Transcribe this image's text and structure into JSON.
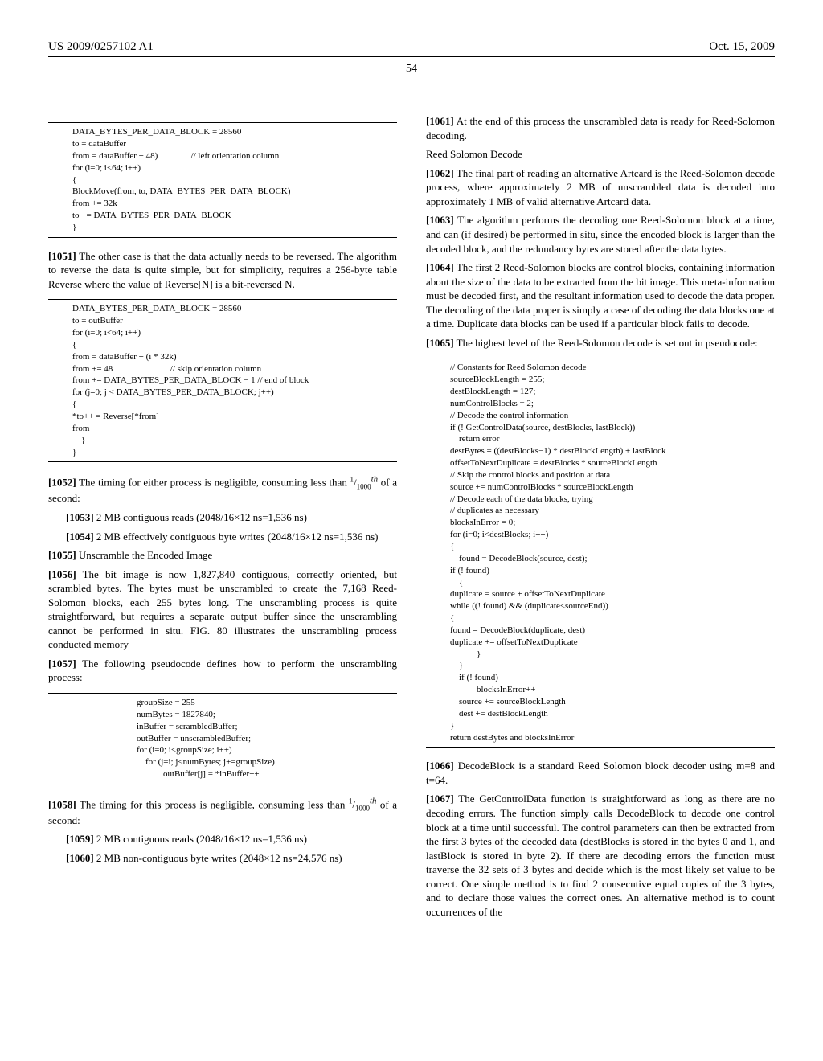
{
  "header": {
    "pub": "US 2009/0257102 A1",
    "date": "Oct. 15, 2009"
  },
  "pagenum": "54",
  "left": {
    "code1": "DATA_BYTES_PER_DATA_BLOCK = 28560\nto = dataBuffer\nfrom = dataBuffer + 48)               // left orientation column\nfor (i=0; i<64; i++)\n{\nBlockMove(from, to, DATA_BYTES_PER_DATA_BLOCK)\nfrom += 32k\nto += DATA_BYTES_PER_DATA_BLOCK\n}",
    "p1051_num": "[1051]",
    "p1051": "   The other case is that the data actually needs to be reversed. The algorithm to reverse the data is quite simple, but for simplicity, requires a 256-byte table Reverse where the value of Reverse[N] is a bit-reversed N.",
    "code2": "DATA_BYTES_PER_DATA_BLOCK = 28560\nto = outBuffer\nfor (i=0; i<64; i++)\n{\nfrom = dataBuffer + (i * 32k)\nfrom += 48                          // skip orientation column\nfrom += DATA_BYTES_PER_DATA_BLOCK − 1 // end of block\nfor (j=0; j < DATA_BYTES_PER_DATA_BLOCK; j++)\n{\n*to++ = Reverse[*from]\nfrom−−\n    }\n}",
    "p1052_num": "[1052]",
    "p1052_a": "   The timing for either process is negligible, consuming less than ",
    "p1052_b": " of a second:",
    "p1053_num": "[1053]",
    "p1053": "   2 MB contiguous reads (2048/16×12 ns=1,536 ns)",
    "p1054_num": "[1054]",
    "p1054": "   2 MB effectively contiguous byte writes (2048/16×12 ns=1,536 ns)",
    "p1055_num": "[1055]",
    "p1055": "   Unscramble the Encoded Image",
    "p1056_num": "[1056]",
    "p1056": "   The bit image is now 1,827,840 contiguous, correctly oriented, but scrambled bytes. The bytes must be unscrambled to create the 7,168 Reed-Solomon blocks, each 255 bytes long. The unscrambling process is quite straightforward, but requires a separate output buffer since the unscrambling cannot be performed in situ. FIG. 80 illustrates the unscrambling process conducted memory",
    "p1057_num": "[1057]",
    "p1057": "   The following pseudocode defines how to perform the unscrambling process:",
    "code3": "groupSize = 255\nnumBytes = 1827840;\ninBuffer = scrambledBuffer;\noutBuffer = unscrambledBuffer;\nfor (i=0; i<groupSize; i++)\n    for (j=i; j<numBytes; j+=groupSize)\n            outBuffer[j] = *inBuffer++",
    "p1058_num": "[1058]",
    "p1058_a": "   The timing for this process is negligible, consuming less than ",
    "p1058_b": " of a second:",
    "p1059_num": "[1059]",
    "p1059": "   2 MB contiguous reads (2048/16×12 ns=1,536 ns)",
    "p1060_num": "[1060]",
    "p1060": "   2 MB non-contiguous byte writes (2048×12 ns=24,576 ns)"
  },
  "right": {
    "p1061_num": "[1061]",
    "p1061": "   At the end of this process the unscrambled data is ready for Reed-Solomon decoding.",
    "sec_head": "Reed Solomon Decode",
    "p1062_num": "[1062]",
    "p1062": "   The final part of reading an alternative Artcard is the Reed-Solomon decode process, where approximately 2 MB of unscrambled data is decoded into approximately 1 MB of valid alternative Artcard data.",
    "p1063_num": "[1063]",
    "p1063": "   The algorithm performs the decoding one Reed-Solomon block at a time, and can (if desired) be performed in situ, since the encoded block is larger than the decoded block, and the redundancy bytes are stored after the data bytes.",
    "p1064_num": "[1064]",
    "p1064": "   The first 2 Reed-Solomon blocks are control blocks, containing information about the size of the data to be extracted from the bit image. This meta-information must be decoded first, and the resultant information used to decode the data proper. The decoding of the data proper is simply a case of decoding the data blocks one at a time. Duplicate data blocks can be used if a particular block fails to decode.",
    "p1065_num": "[1065]",
    "p1065": "   The highest level of the Reed-Solomon decode is set out in pseudocode:",
    "code4": "// Constants for Reed Solomon decode\nsourceBlockLength = 255;\ndestBlockLength = 127;\nnumControlBlocks = 2;\n// Decode the control information\nif (! GetControlData(source, destBlocks, lastBlock))\n    return error\ndestBytes = ((destBlocks−1) * destBlockLength) + lastBlock\noffsetToNextDuplicate = destBlocks * sourceBlockLength\n// Skip the control blocks and position at data\nsource += numControlBlocks * sourceBlockLength\n// Decode each of the data blocks, trying\n// duplicates as necessary\nblocksInError = 0;\nfor (i=0; i<destBlocks; i++)\n{\n    found = DecodeBlock(source, dest);\nif (! found)\n    {\nduplicate = source + offsetToNextDuplicate\nwhile ((! found) && (duplicate<sourceEnd))\n{\nfound = DecodeBlock(duplicate, dest)\nduplicate += offsetToNextDuplicate\n            }\n    }\n    if (! found)\n            blocksInError++\n    source += sourceBlockLength\n    dest += destBlockLength\n}\nreturn destBytes and blocksInError",
    "p1066_num": "[1066]",
    "p1066": "   DecodeBlock is a standard Reed Solomon block decoder using m=8 and t=64.",
    "p1067_num": "[1067]",
    "p1067": "   The GetControlData function is straightforward as long as there are no decoding errors. The function simply calls DecodeBlock to decode one control block at a time until successful. The control parameters can then be extracted from the first 3 bytes of the decoded data (destBlocks is stored in the bytes 0 and 1, and lastBlock is stored in byte 2). If there are decoding errors the function must traverse the 32 sets of 3 bytes and decide which is the most likely set value to be correct. One simple method is to find 2 consecutive equal copies of the 3 bytes, and to declare those values the correct ones. An alternative method is to count occurrences of the"
  }
}
